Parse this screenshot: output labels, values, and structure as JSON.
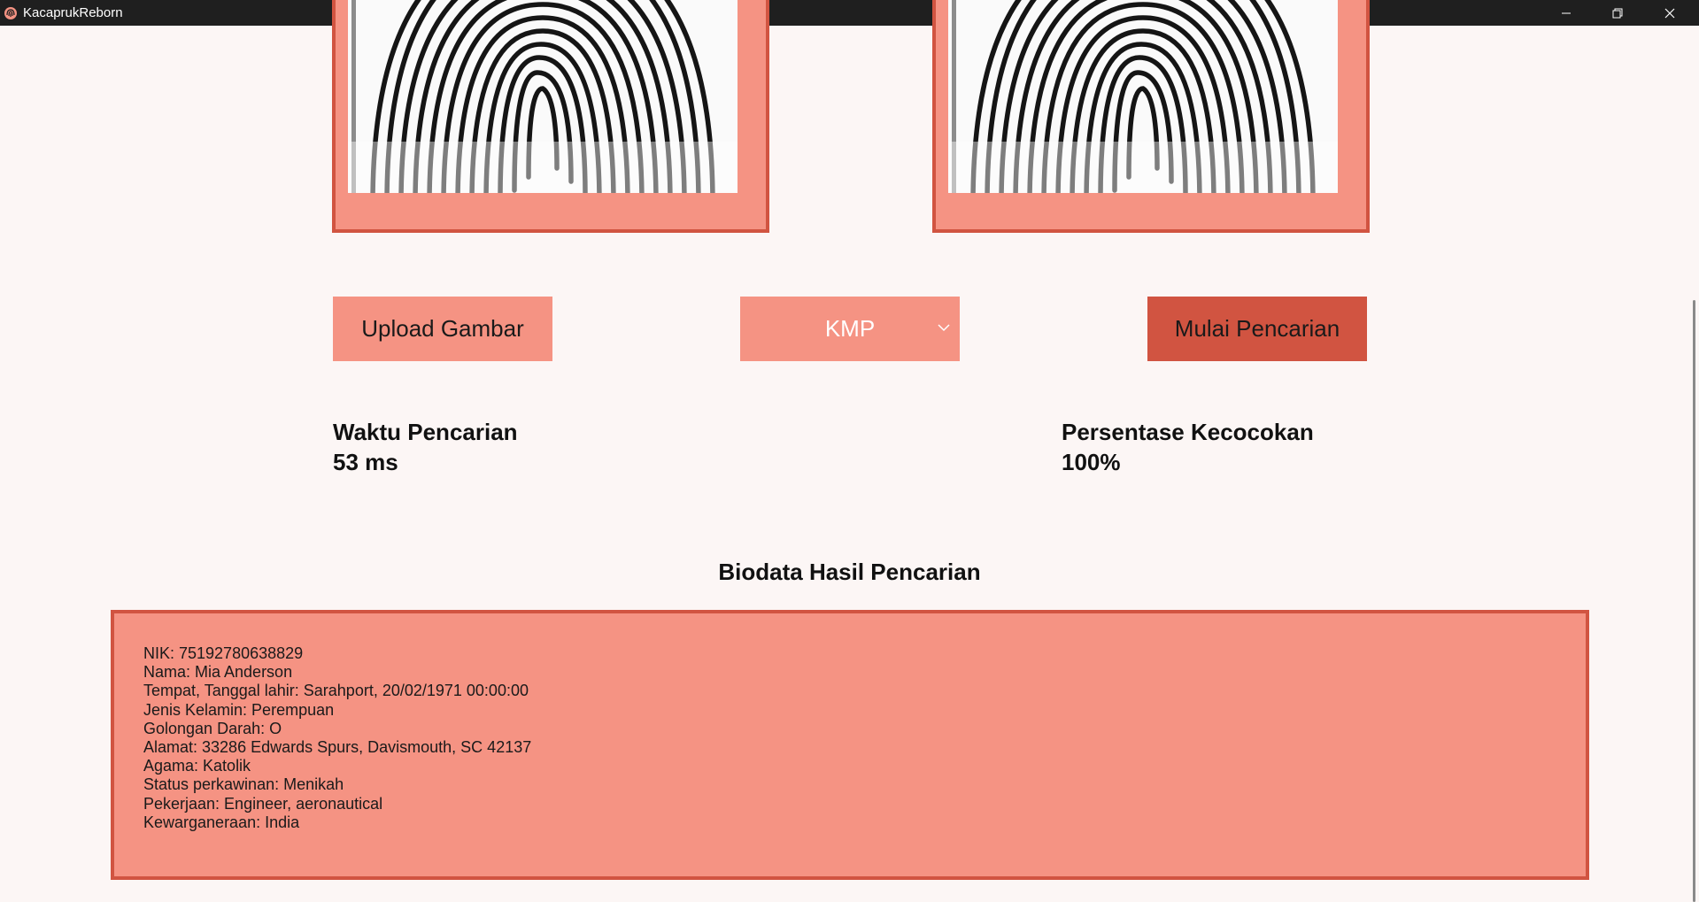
{
  "window": {
    "title": "KacaprukReborn"
  },
  "controls": {
    "upload_label": "Upload Gambar",
    "algorithm_selected": "KMP",
    "search_label": "Mulai Pencarian"
  },
  "stats": {
    "time_label": "Waktu Pencarian",
    "time_value": "53 ms",
    "match_label": "Persentase Kecocokan",
    "match_value": "100%"
  },
  "biodata": {
    "title": "Biodata Hasil Pencarian",
    "lines": [
      "NIK: 75192780638829",
      "Nama: Mia Anderson",
      "Tempat, Tanggal lahir: Sarahport, 20/02/1971 00:00:00",
      "Jenis Kelamin: Perempuan",
      "Golongan Darah: O",
      "Alamat: 33286 Edwards Spurs, Davismouth, SC 42137",
      "Agama: Katolik",
      "Status perkawinan: Menikah",
      "Pekerjaan: Engineer, aeronautical",
      "Kewarganeraan: India"
    ]
  },
  "colors": {
    "titlebar": "#1f1f1f",
    "background": "#fcf6f5",
    "salmon": "#f59383",
    "accent": "#d15441"
  },
  "icons": {
    "app": "fingerprint-icon",
    "minimize": "minimize-icon",
    "restore": "restore-icon",
    "close": "close-icon",
    "dropdown": "chevron-down-icon"
  }
}
